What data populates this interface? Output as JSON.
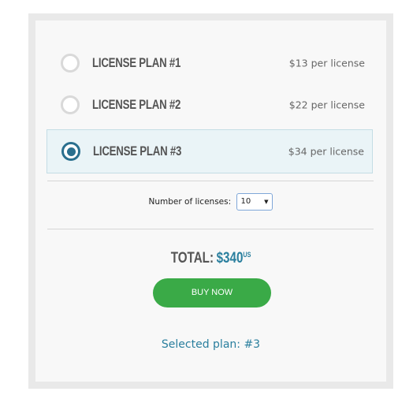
{
  "plans": [
    {
      "name": "LICENSE PLAN #1",
      "price": "$13 per license",
      "selected": false
    },
    {
      "name": "LICENSE PLAN #2",
      "price": "$22 per license",
      "selected": false
    },
    {
      "name": "LICENSE PLAN #3",
      "price": "$34 per license",
      "selected": true
    }
  ],
  "quantity": {
    "label": "Number of licenses:",
    "value": "10",
    "caret": "▼"
  },
  "total": {
    "label": "TOTAL:",
    "amount": "$340",
    "unit": "US"
  },
  "buy_label": "BUY NOW",
  "selected_plan_text": "Selected plan: #3",
  "colors": {
    "accent": "#2a7f9e",
    "radio_checked": "#2a6f8e",
    "buy_button": "#3aaa47",
    "selected_row_bg": "#eaf4f7"
  }
}
